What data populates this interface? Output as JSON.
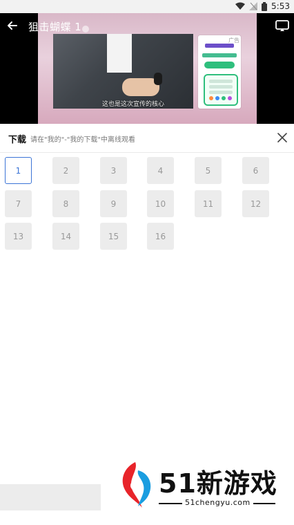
{
  "status_bar": {
    "time": "5:53"
  },
  "player": {
    "title": "狙击蝴蝶 1",
    "subtitle_caption": "这也是这次宣传的核心",
    "ad_tag": "广告"
  },
  "download_panel": {
    "title": "下载",
    "hint": "请在\"我的\"-\"我的下载\"中离线观看",
    "selected_episode": 1,
    "episodes": [
      "1",
      "2",
      "3",
      "4",
      "5",
      "6",
      "7",
      "8",
      "9",
      "10",
      "11",
      "12",
      "13",
      "14",
      "15",
      "16"
    ]
  },
  "watermark": {
    "brand": "51新游戏",
    "site": "51chengyu.com"
  },
  "colors": {
    "accent": "#3b74d6",
    "episode_bg": "#ececec",
    "episode_text": "#999999"
  }
}
